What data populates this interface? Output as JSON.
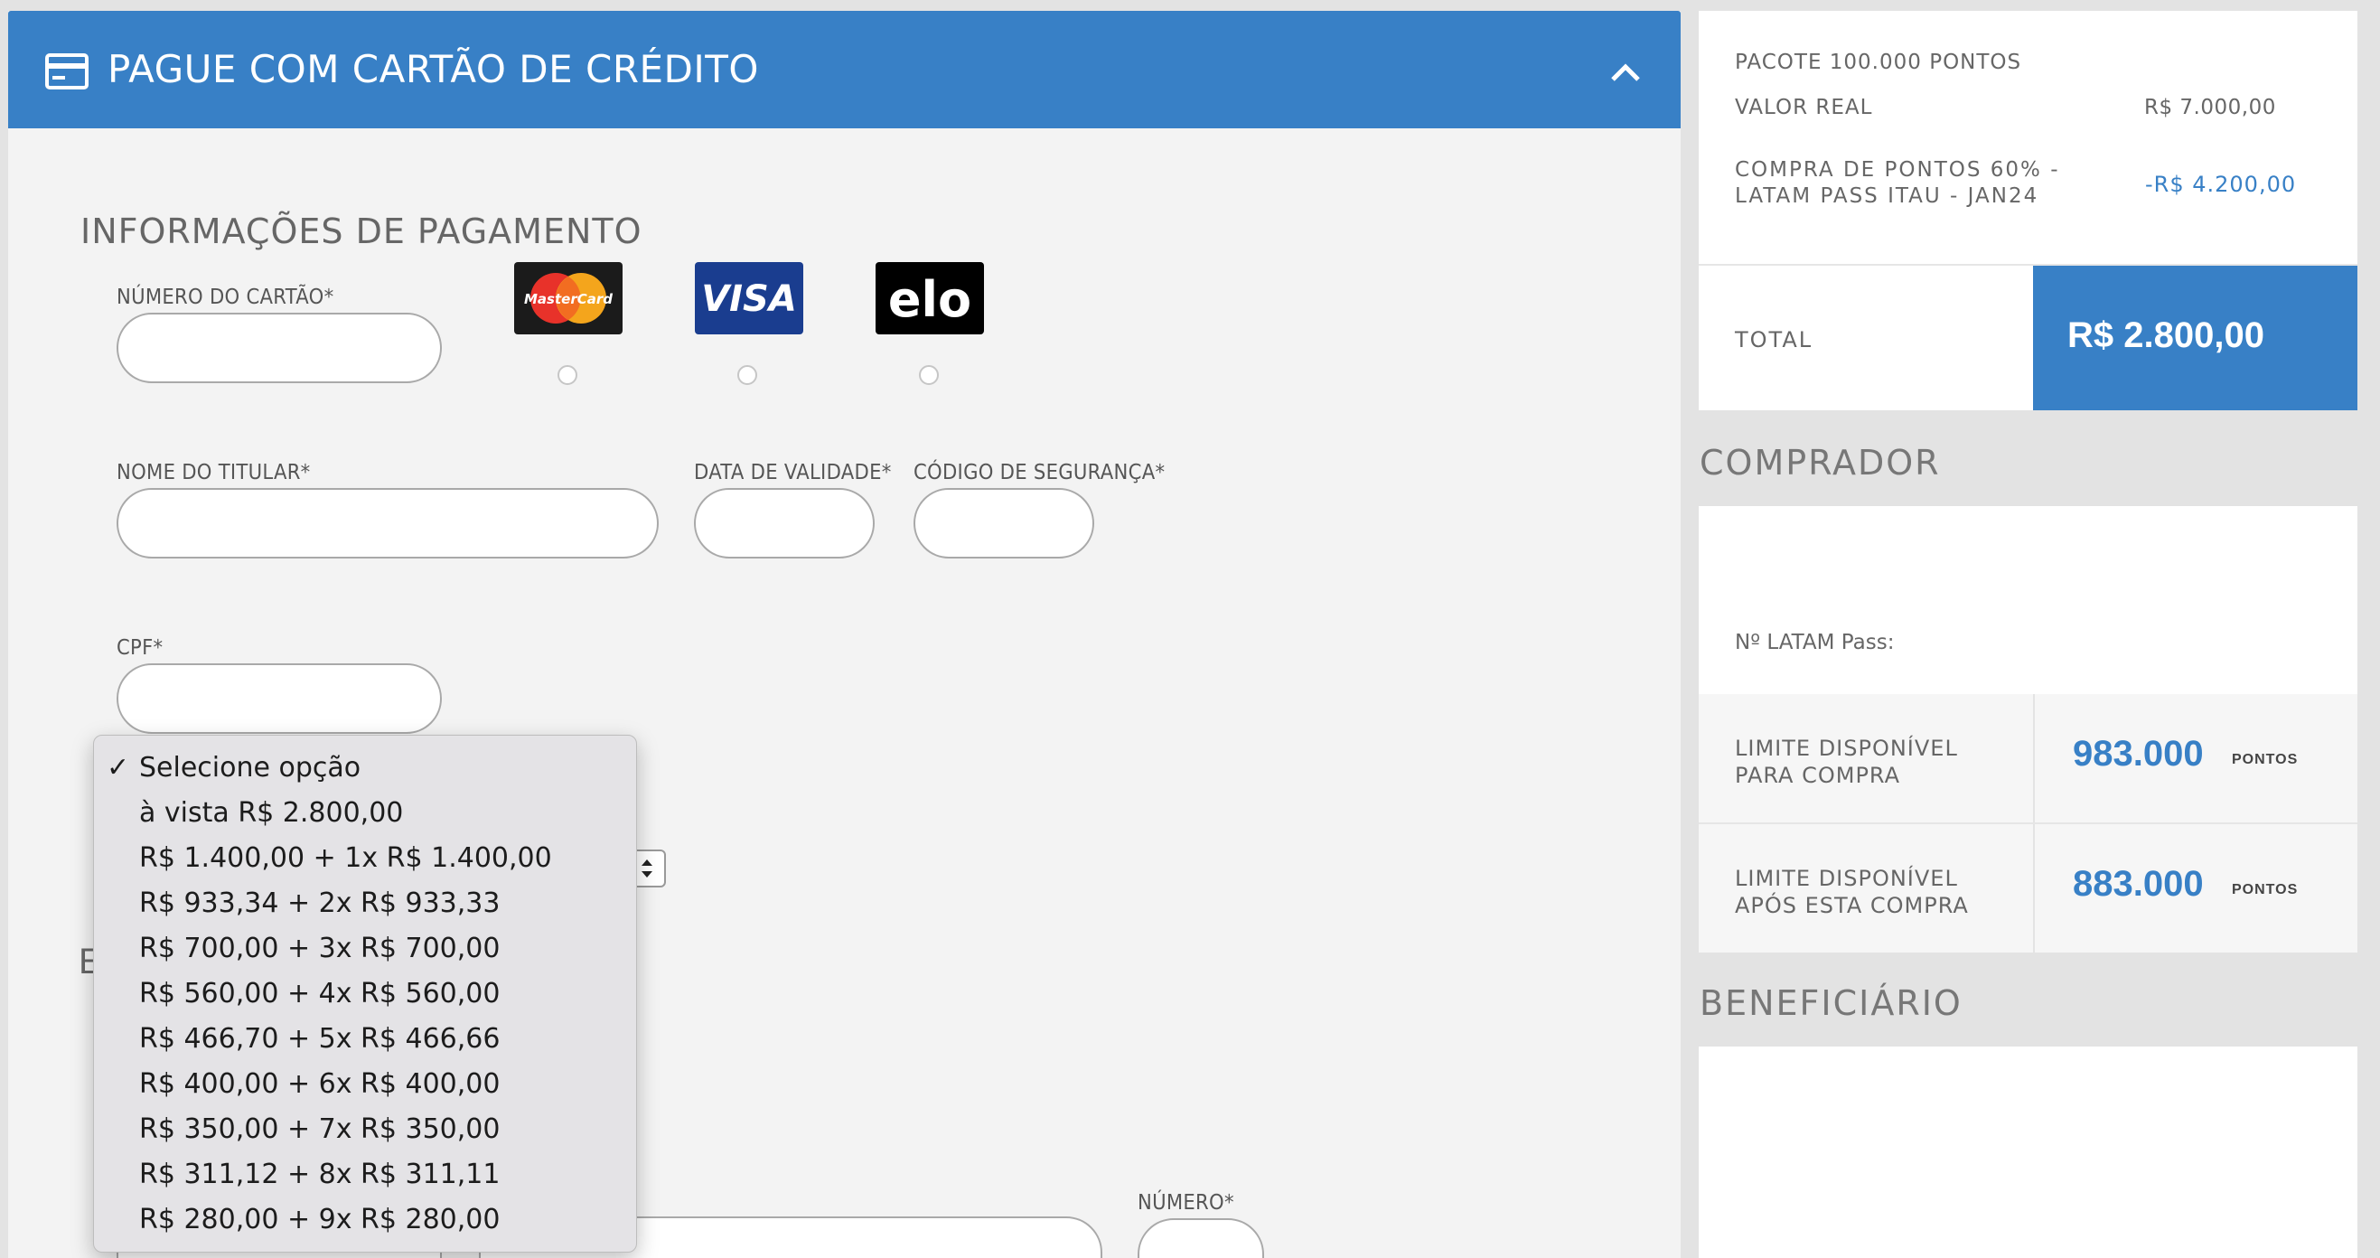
{
  "header": {
    "title": "PAGUE COM CARTÃO DE CRÉDITO",
    "card_icon": "credit-card-icon",
    "collapse_icon": "chevron-up-icon",
    "bg_color": "#3880c6"
  },
  "payment_info": {
    "section_title": "INFORMAÇÕES DE PAGAMENTO",
    "card_number_label": "NÚMERO DO CARTÃO*",
    "card_number_value": "",
    "holder_name_label": "NOME DO TITULAR*",
    "holder_name_value": "",
    "expiry_label": "DATA DE VALIDADE*",
    "expiry_value": "",
    "cvv_label": "CÓDIGO DE SEGURANÇA*",
    "cvv_value": "",
    "cpf_label": "CPF*",
    "cpf_value": "",
    "number_label": "NÚMERO*",
    "truncated_heading_letter": "E",
    "brands": [
      {
        "name": "MasterCard",
        "selected": false
      },
      {
        "name": "VISA",
        "selected": false
      },
      {
        "name": "elo",
        "selected": false
      }
    ]
  },
  "installments_dropdown": {
    "selected_index": 0,
    "options": [
      "Selecione opção",
      "à vista R$ 2.800,00",
      "R$ 1.400,00 + 1x R$ 1.400,00",
      "R$ 933,34 + 2x R$ 933,33",
      "R$ 700,00 + 3x R$ 700,00",
      "R$ 560,00 + 4x R$ 560,00",
      "R$ 466,70 + 5x R$ 466,66",
      "R$ 400,00 + 6x R$ 400,00",
      "R$ 350,00 + 7x R$ 350,00",
      "R$ 311,12 + 8x R$ 311,11",
      "R$ 280,00 + 9x R$ 280,00"
    ]
  },
  "summary": {
    "package": "PACOTE 100.000 PONTOS",
    "real_value_label": "VALOR REAL",
    "real_value": "R$ 7.000,00",
    "discount_label_line1": "COMPRA DE PONTOS 60% -",
    "discount_label_line2": "LATAM PASS ITAU - JAN24",
    "discount_value": "-R$ 4.200,00",
    "total_label": "TOTAL",
    "total_value": "R$ 2.800,00",
    "accent_color": "#3880c6"
  },
  "buyer": {
    "heading": "COMPRADOR",
    "latam_pass_label": "Nº LATAM Pass:",
    "limit_available_line1": "LIMITE DISPONÍVEL",
    "limit_available_line2": "PARA COMPRA",
    "limit_available_value": "983.000",
    "limit_after_line1": "LIMITE DISPONÍVEL",
    "limit_after_line2": "APÓS ESTA COMPRA",
    "limit_after_value": "883.000",
    "points_unit": "PONTOS"
  },
  "beneficiary": {
    "heading": "BENEFICIÁRIO"
  }
}
